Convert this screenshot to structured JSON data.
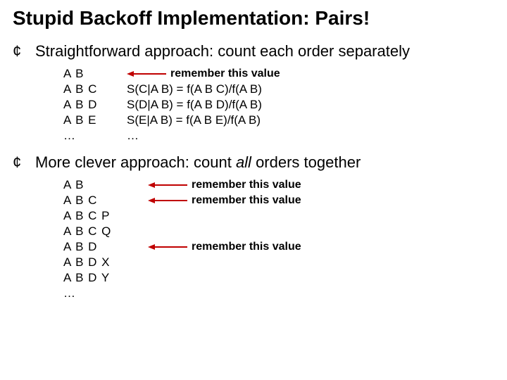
{
  "title": "Stupid Backoff Implementation: Pairs!",
  "bullet1": {
    "text_pre": "Straightforward approach: count each order separately"
  },
  "block1": {
    "rows": [
      {
        "ngram": "A B",
        "annot": "remember this value"
      },
      {
        "ngram": "A B C",
        "formula": "S(C|A B) = f(A B C)/f(A B)"
      },
      {
        "ngram": "A B D",
        "formula": "S(D|A B) = f(A B D)/f(A B)"
      },
      {
        "ngram": "A B E",
        "formula": "S(E|A B) = f(A B E)/f(A B)"
      },
      {
        "ngram": "…",
        "formula": "…"
      }
    ]
  },
  "bullet2": {
    "pre": "More clever approach: count ",
    "ital": "all",
    "post": " orders together"
  },
  "block2": {
    "rows": [
      {
        "ngram": "A B",
        "annot": "remember this value"
      },
      {
        "ngram": "A B C",
        "annot": "remember this value"
      },
      {
        "ngram": "A B C P"
      },
      {
        "ngram": "A B C Q"
      },
      {
        "ngram": "A B D",
        "annot": "remember this value"
      },
      {
        "ngram": "A B D X"
      },
      {
        "ngram": "A B D Y"
      },
      {
        "ngram": "…"
      }
    ]
  }
}
